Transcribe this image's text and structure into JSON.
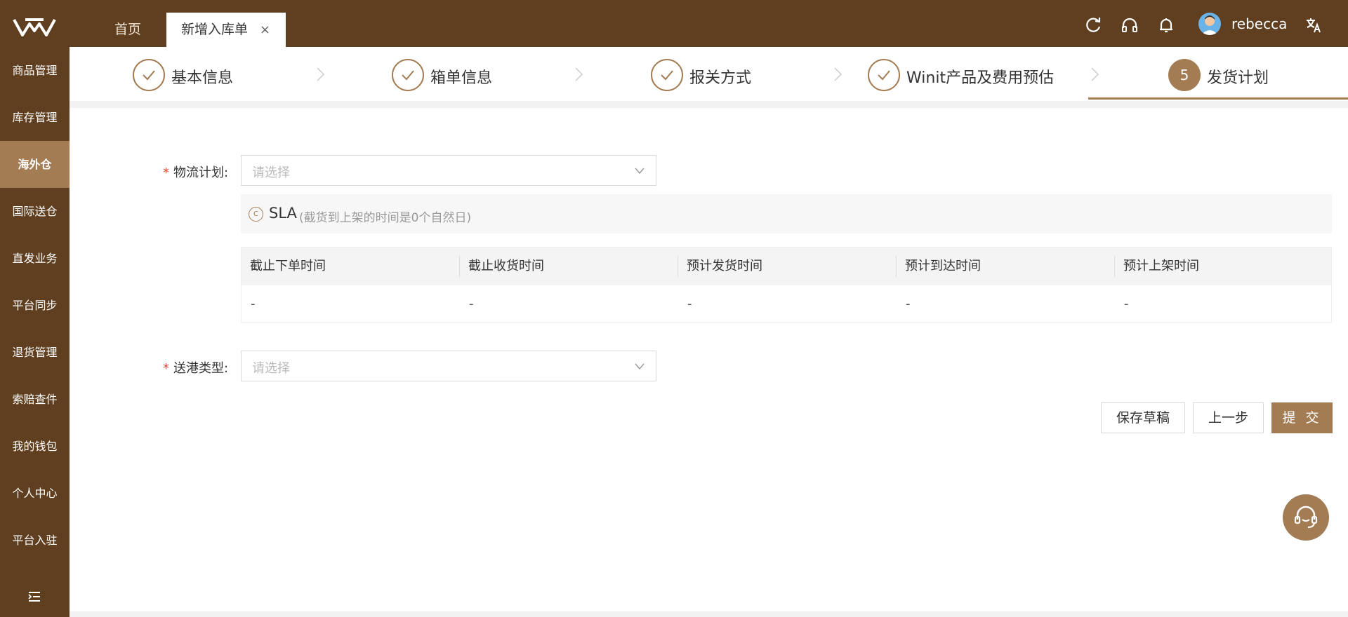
{
  "header": {
    "tabs": [
      {
        "label": "首页"
      },
      {
        "label": "新增入库单",
        "close": "×"
      }
    ],
    "icons": [
      "refresh-icon",
      "headset-icon",
      "bell-icon",
      "translate-icon"
    ],
    "user": {
      "name": "rebecca"
    }
  },
  "sidebar": {
    "items": [
      {
        "label": "商品管理"
      },
      {
        "label": "库存管理"
      },
      {
        "label": "海外仓",
        "active": true
      },
      {
        "label": "国际送仓"
      },
      {
        "label": "直发业务"
      },
      {
        "label": "平台同步"
      },
      {
        "label": "退货管理"
      },
      {
        "label": "索赔查件"
      },
      {
        "label": "我的钱包"
      },
      {
        "label": "个人中心"
      },
      {
        "label": "平台入驻"
      }
    ]
  },
  "steps": [
    {
      "label": "基本信息",
      "status": "done"
    },
    {
      "label": "箱单信息",
      "status": "done"
    },
    {
      "label": "报关方式",
      "status": "done"
    },
    {
      "label": "Winit产品及费用预估",
      "status": "done"
    },
    {
      "label": "发货计划",
      "status": "current",
      "number": "5"
    }
  ],
  "form": {
    "logistics_plan": {
      "label": "物流计划:",
      "placeholder": "请选择"
    },
    "port_type": {
      "label": "送港类型:",
      "placeholder": "请选择"
    },
    "required_mark": "*"
  },
  "sla": {
    "icon_text": "C",
    "title": "SLA",
    "note": "(截货到上架的时间是0个自然日)"
  },
  "table": {
    "headers": [
      "截止下单时间",
      "截止收货时间",
      "预计发货时间",
      "预计到达时间",
      "预计上架时间"
    ],
    "row": [
      "-",
      "-",
      "-",
      "-",
      "-"
    ]
  },
  "buttons": {
    "save_draft": "保存草稿",
    "prev_step": "上一步",
    "submit": "提 交"
  },
  "colors": {
    "brand_dark": "#5f3f1f",
    "accent": "#a37c54",
    "required": "#e04a3a"
  }
}
